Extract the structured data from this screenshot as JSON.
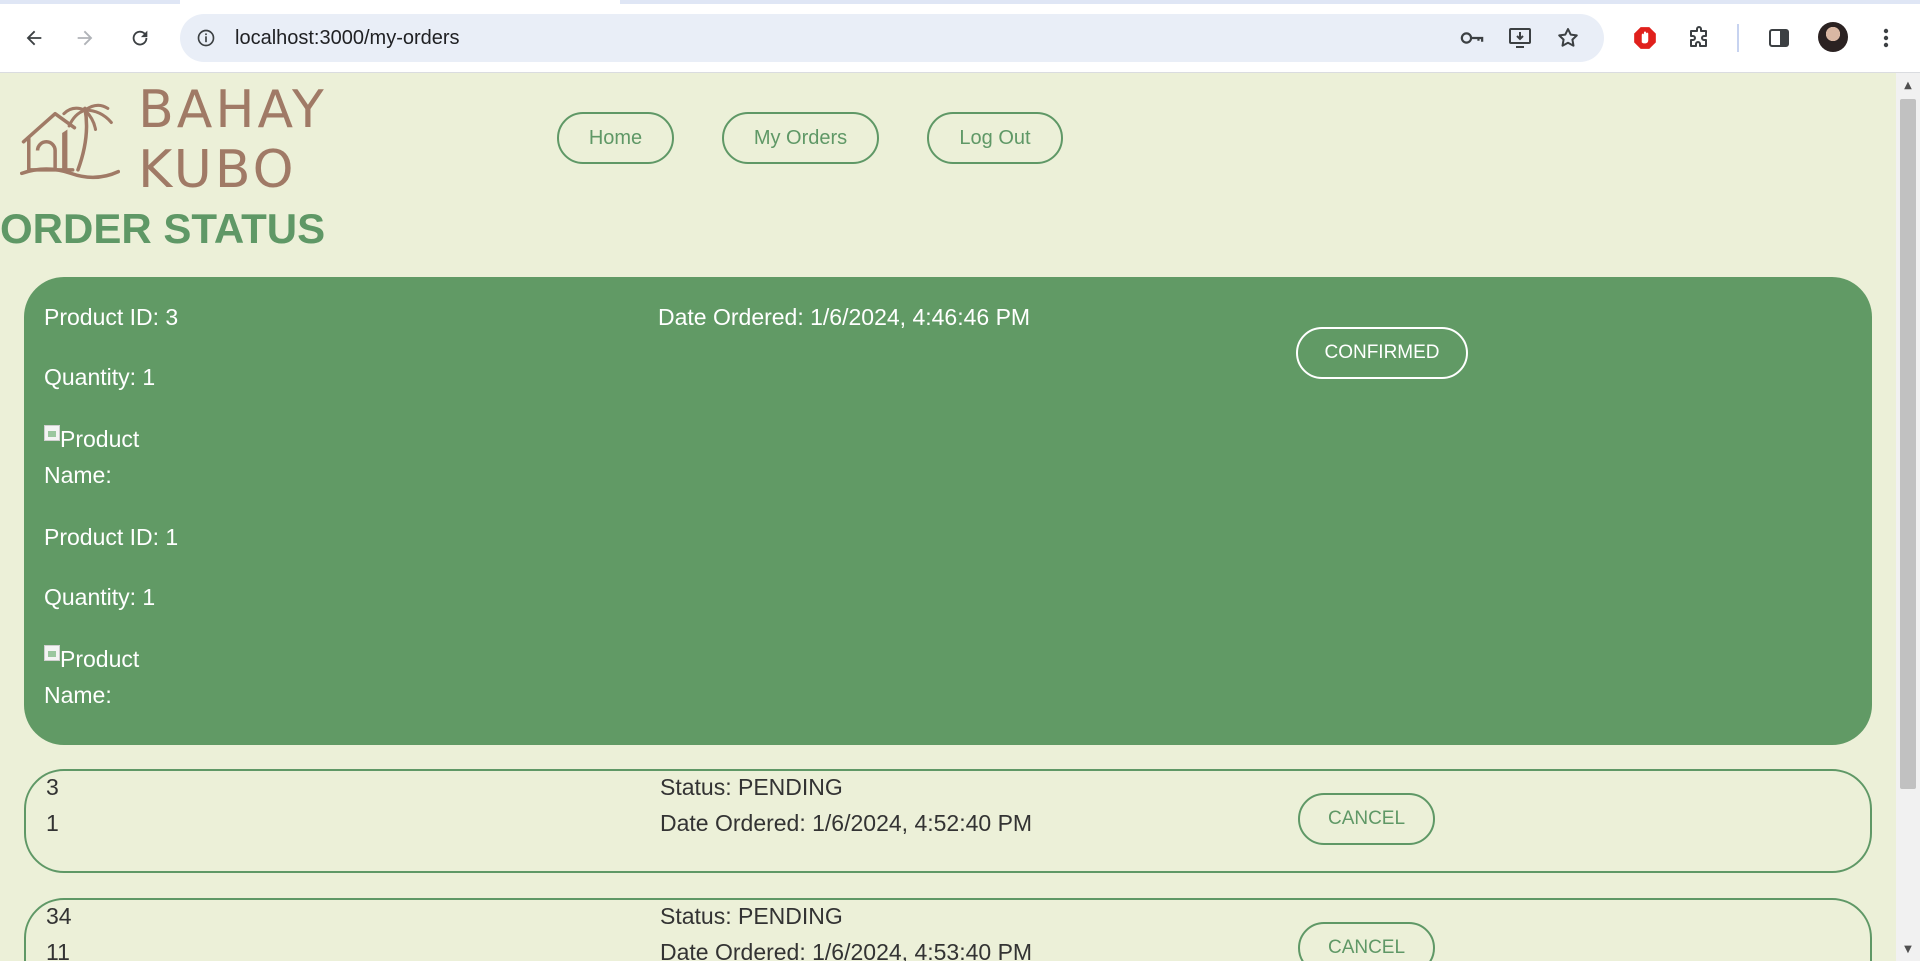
{
  "browser": {
    "url": "localhost:3000/my-orders"
  },
  "header": {
    "logo_text": "BAHAY KUBO",
    "nav": [
      {
        "label": "Home"
      },
      {
        "label": "My Orders"
      },
      {
        "label": "Log Out"
      }
    ]
  },
  "page": {
    "title": "ORDER STATUS"
  },
  "orders": {
    "confirmed": {
      "items": [
        {
          "product_id": "Product ID: 3",
          "quantity": "Quantity: 1",
          "image_alt": "Product",
          "name": "Name:"
        },
        {
          "product_id": "Product ID: 1",
          "quantity": "Quantity: 1",
          "image_alt": "Product",
          "name": "Name:"
        }
      ],
      "date": "Date Ordered: 1/6/2024, 4:46:46 PM",
      "status_label": "CONFIRMED"
    },
    "pending1": {
      "line1": "3",
      "line2": "1",
      "status": "Status: PENDING",
      "date": "Date Ordered: 1/6/2024, 4:52:40 PM",
      "button": "CANCEL"
    },
    "pending2": {
      "line1": "34",
      "line2": "11",
      "status": "Status: PENDING",
      "date": "Date Ordered: 1/6/2024, 4:53:40 PM",
      "button": "CANCEL"
    }
  },
  "colors": {
    "page_bg": "#ecf0d8",
    "accent": "#5f9866",
    "logo": "#a07a66"
  }
}
